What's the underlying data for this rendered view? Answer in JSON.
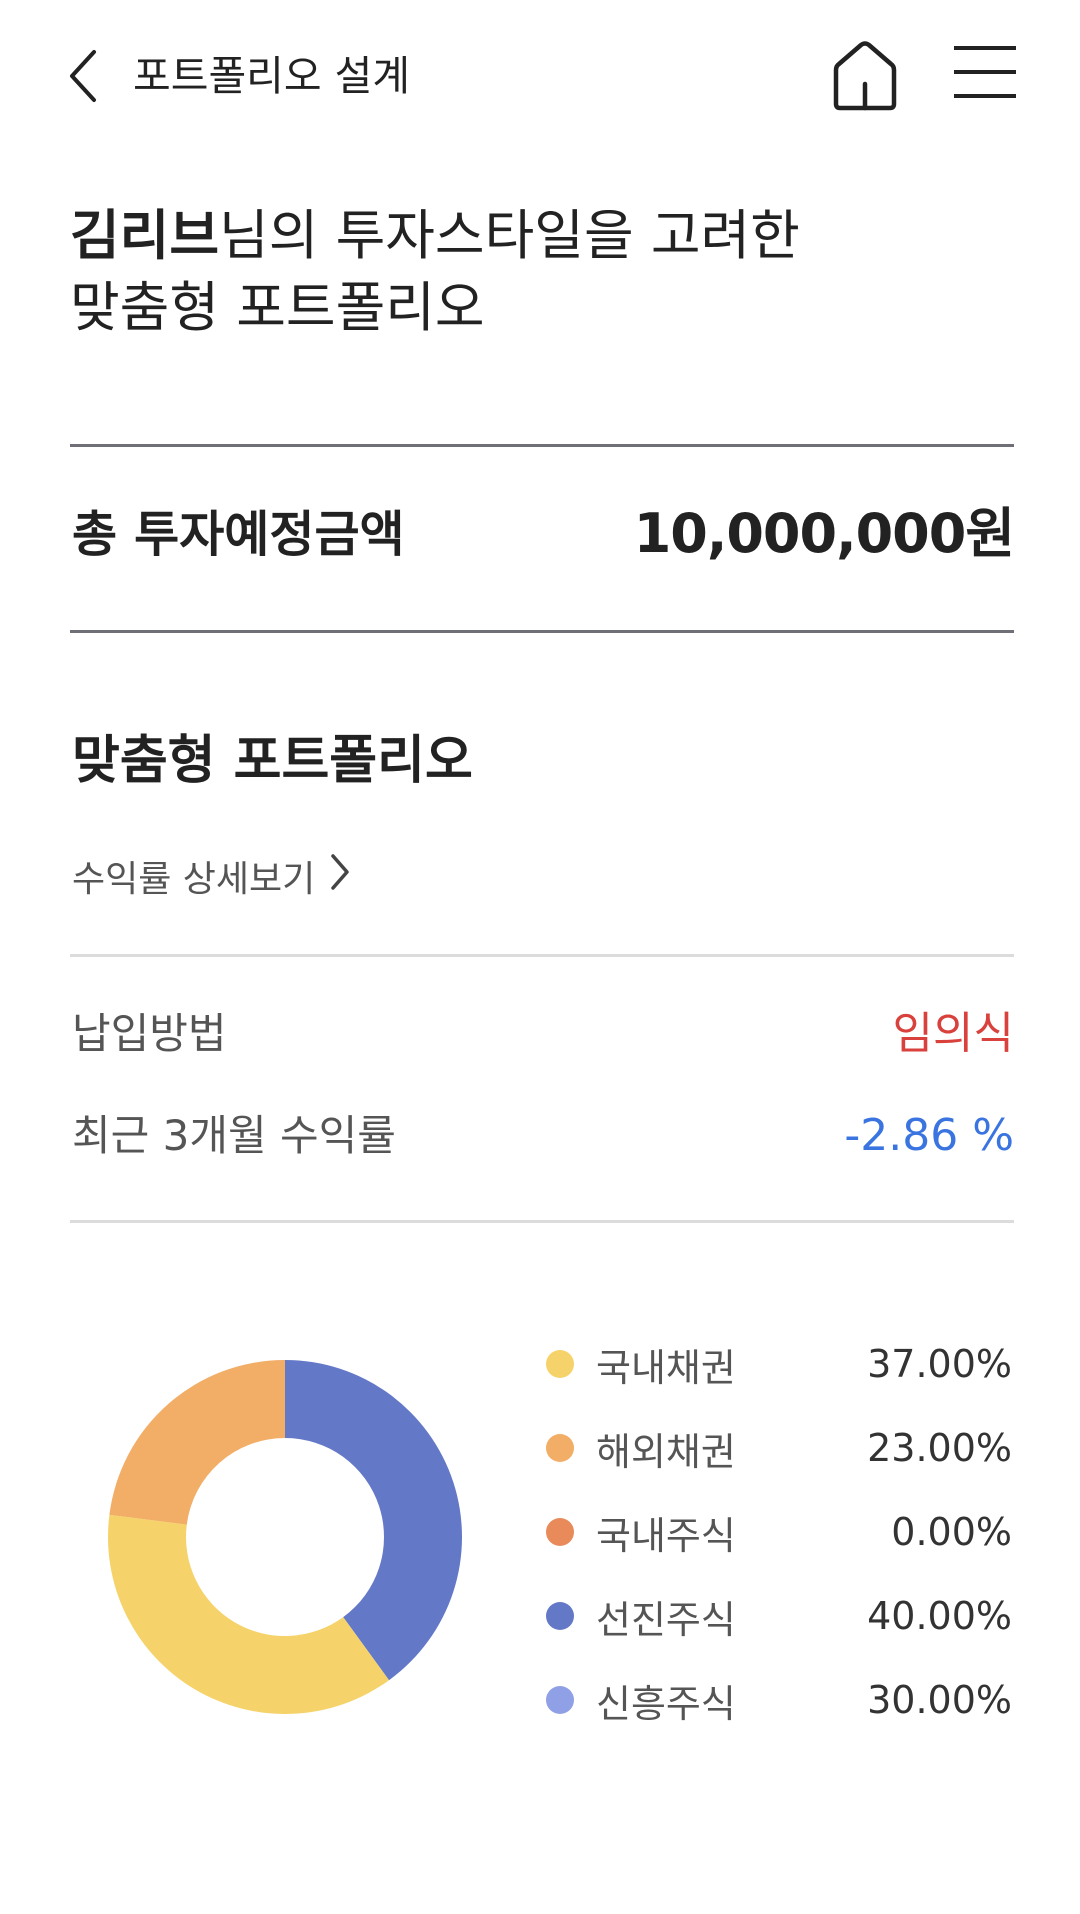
{
  "header": {
    "title": "포트폴리오 설계"
  },
  "headline": {
    "name": "김리브",
    "line1_rest": "님의 투자스타일을 고려한",
    "line2": "맞춤형 포트폴리오"
  },
  "total": {
    "label": "총 투자예정금액",
    "value": "10,000,000원"
  },
  "portfolio": {
    "title": "맞춤형 포트폴리오",
    "detail_link": "수익률 상세보기",
    "payment_label": "납입방법",
    "payment_value": "임의식",
    "return_label": "최근 3개월 수익률",
    "return_value": "-2.86 %"
  },
  "colors": {
    "domestic_bond": "#f5d36a",
    "foreign_bond": "#f2ad66",
    "domestic_stock": "#e98a5a",
    "developed_stock": "#6478c8",
    "emerging_stock": "#8fa0e6",
    "negative_return": "#3a74e0",
    "payment_accent": "#d9413c"
  },
  "allocation": [
    {
      "label": "국내채권",
      "value": "37.00%",
      "color": "#f5d36a"
    },
    {
      "label": "해외채권",
      "value": "23.00%",
      "color": "#f2ad66"
    },
    {
      "label": "국내주식",
      "value": "0.00%",
      "color": "#e98a5a"
    },
    {
      "label": "선진주식",
      "value": "40.00%",
      "color": "#6478c8"
    },
    {
      "label": "신흥주식",
      "value": "30.00%",
      "color": "#8fa0e6"
    }
  ],
  "chart_data": {
    "type": "pie",
    "categories": [
      "선진주식",
      "국내채권",
      "해외채권"
    ],
    "values": [
      40,
      37,
      23
    ],
    "colors": [
      "#6478c8",
      "#f5d36a",
      "#f2ad66"
    ]
  }
}
